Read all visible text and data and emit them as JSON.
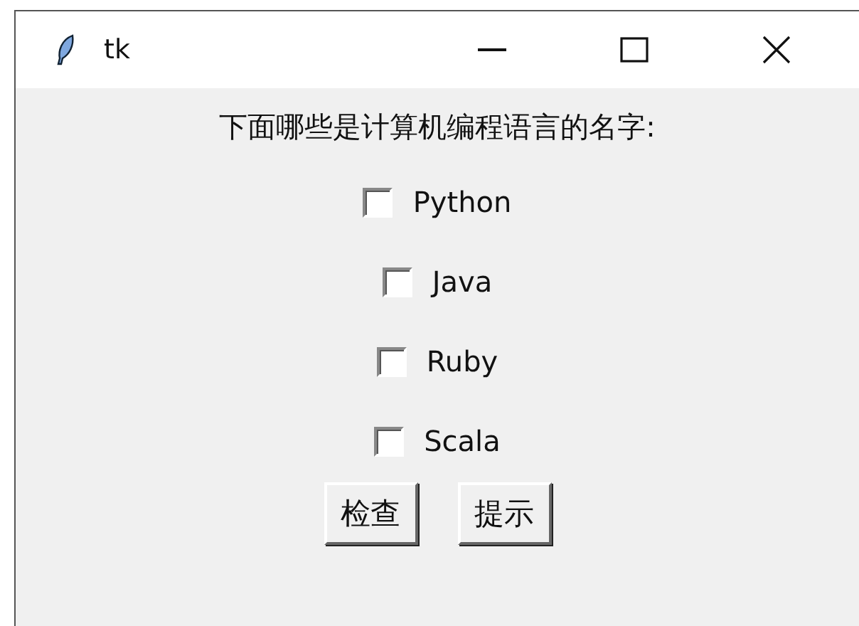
{
  "window": {
    "title": "tk"
  },
  "question": "下面哪些是计算机编程语言的名字:",
  "options": [
    {
      "label": "Python",
      "checked": false
    },
    {
      "label": "Java",
      "checked": false
    },
    {
      "label": "Ruby",
      "checked": false
    },
    {
      "label": "Scala",
      "checked": false
    }
  ],
  "buttons": [
    "检查",
    "提示"
  ]
}
